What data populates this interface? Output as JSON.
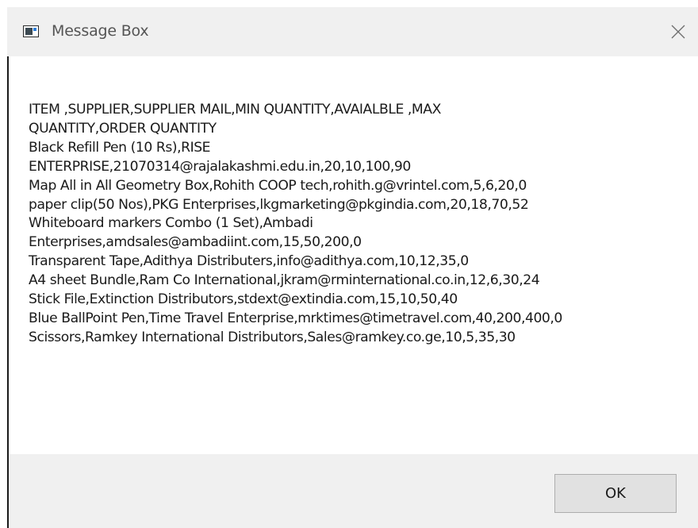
{
  "window": {
    "title": "Message Box",
    "close_icon": "close-icon",
    "app_icon": "window-app-icon"
  },
  "message": {
    "lines": [
      "ITEM ,SUPPLIER,SUPPLIER MAIL,MIN QUANTITY,AVAIALBLE ,MAX",
      "QUANTITY,ORDER QUANTITY",
      "Black Refill Pen (10 Rs),RISE",
      "ENTERPRISE,21070314@rajalakashmi.edu.in,20,10,100,90",
      "Map All in All Geometry Box,Rohith COOP tech,rohith.g@vrintel.com,5,6,20,0",
      "paper clip(50 Nos),PKG Enterprises,lkgmarketing@pkgindia.com,20,18,70,52",
      "Whiteboard markers Combo (1 Set),Ambadi",
      "Enterprises,amdsales@ambadiint.com,15,50,200,0",
      "Transparent Tape,Adithya Distributers,info@adithya.com,10,12,35,0",
      "A4 sheet Bundle,Ram Co International,jkram@rminternational.co.in,12,6,30,24",
      "Stick File,Extinction Distributors,stdext@extindia.com,15,10,50,40",
      "Blue BallPoint Pen,Time Travel Enterprise,mrktimes@timetravel.com,40,200,400,0",
      "Scissors,Ramkey International Distributors,Sales@ramkey.co.ge,10,5,35,30"
    ]
  },
  "footer": {
    "ok_label": "OK"
  },
  "colors": {
    "titlebar_bg": "#f0f0f0",
    "footer_bg": "#f0f0f0",
    "button_bg": "#e1e1e1",
    "button_border": "#adadad",
    "text": "#1a1a1a"
  }
}
